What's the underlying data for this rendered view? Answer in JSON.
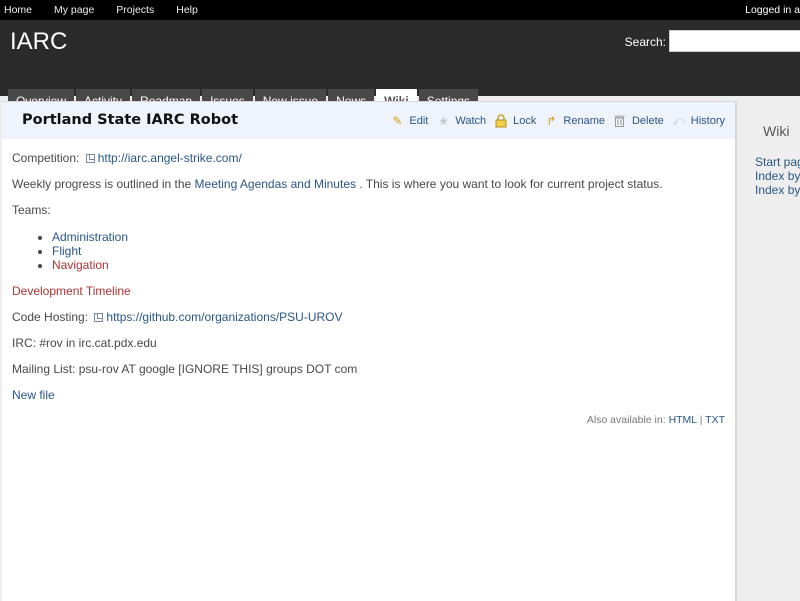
{
  "top_menu": {
    "items": [
      "Home",
      "My page",
      "Projects",
      "Help"
    ],
    "logged_in": "Logged in a"
  },
  "header": {
    "title": "IARC",
    "search_label": "Search:"
  },
  "main_menu": {
    "tabs": [
      "Overview",
      "Activity",
      "Roadmap",
      "Issues",
      "New issue",
      "News",
      "Wiki",
      "Settings"
    ],
    "selected": "Wiki"
  },
  "page": {
    "title": "Portland State IARC Robot",
    "actions": {
      "edit": "Edit",
      "watch": "Watch",
      "lock": "Lock",
      "rename": "Rename",
      "delete": "Delete",
      "history": "History"
    },
    "competition_label": "Competition:",
    "competition_url": "http://iarc.angel-strike.com/",
    "progress_before": "Weekly progress is outlined in the",
    "progress_link": "Meeting Agendas and Minutes",
    "progress_after": ". This is where you want to look for current project status.",
    "teams_label": "Teams:",
    "teams": [
      "Administration",
      "Flight",
      "Navigation"
    ],
    "timeline": "Development Timeline",
    "hosting_label": "Code Hosting:",
    "hosting_url": "https://github.com/organizations/PSU-UROV",
    "irc": "IRC: #rov in irc.cat.pdx.edu",
    "mailing": "Mailing List: psu-rov AT google [IGNORE THIS] groups DOT com",
    "new_file": "New file",
    "available_label": "Also available in:",
    "formats": [
      "HTML",
      "TXT"
    ],
    "separator": "|"
  },
  "sidebar": {
    "title": "Wiki",
    "links": [
      "Start pag",
      "Index by",
      "Index by"
    ]
  },
  "colors": {
    "link": "#2a5685",
    "new_wiki_link": "#aa3333",
    "header_bg": "#2b2b2b",
    "page_header_bg": "#eef3fc"
  }
}
